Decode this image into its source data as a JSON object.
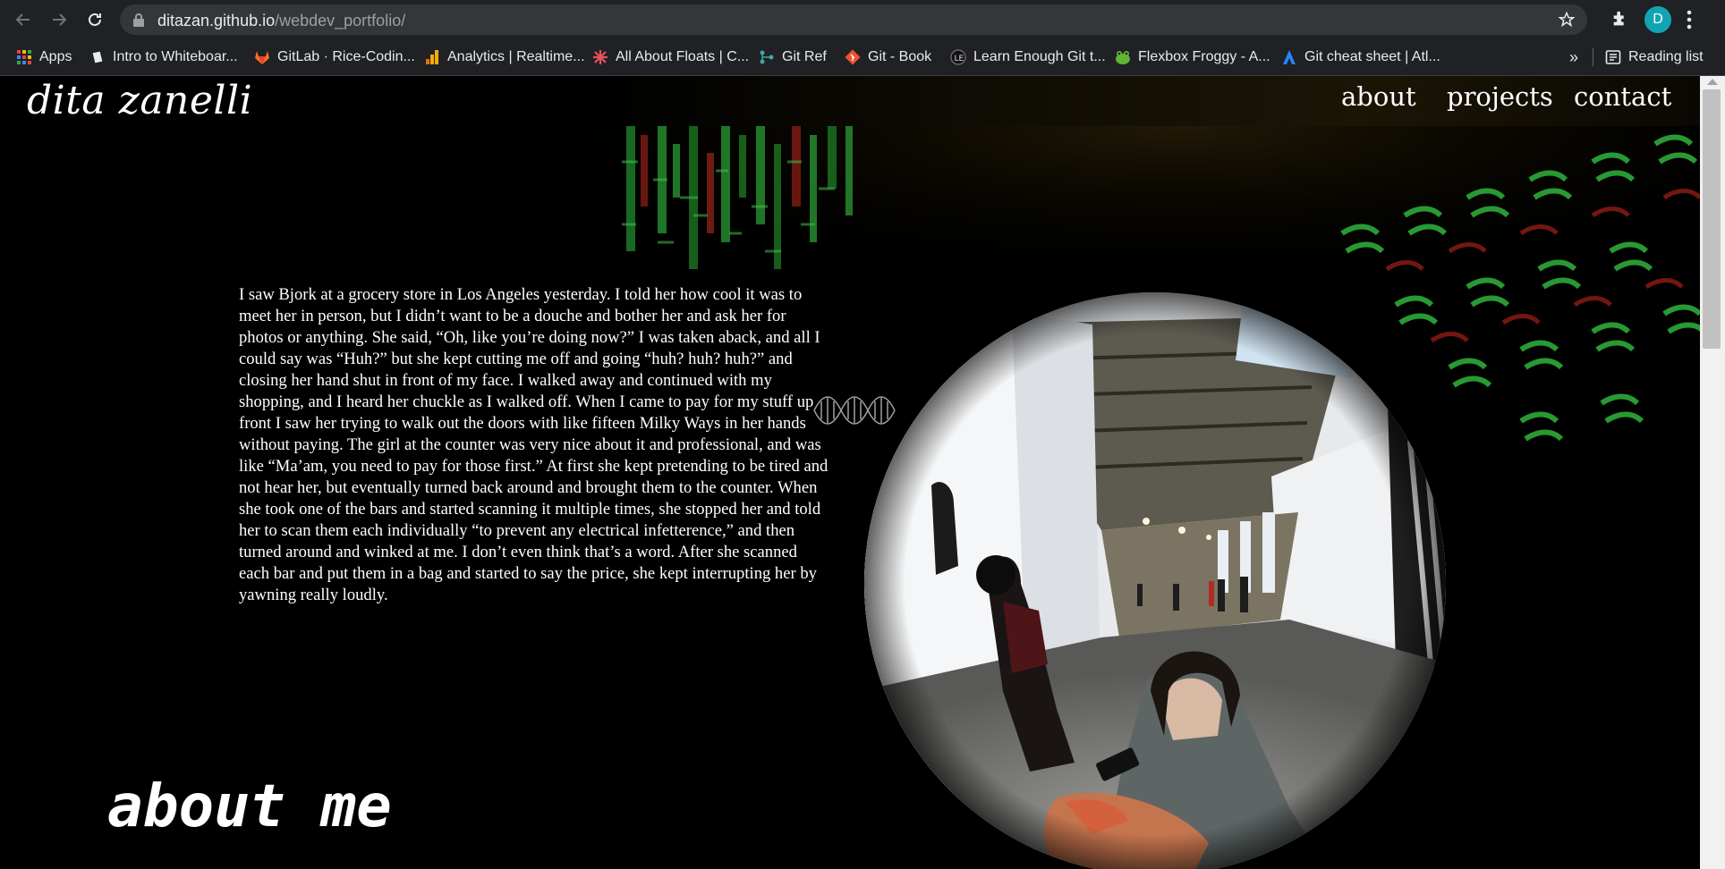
{
  "browser": {
    "url_host": "ditazan.github.io",
    "url_path": "/webdev_portfolio/",
    "profile_initial": "D",
    "bookmarks": [
      {
        "label": "Apps",
        "icon": "apps-grid-icon"
      },
      {
        "label": "Intro to Whiteboar...",
        "icon": "document-icon"
      },
      {
        "label": "GitLab · Rice-Codin...",
        "icon": "gitlab-icon"
      },
      {
        "label": "Analytics | Realtime...",
        "icon": "analytics-icon"
      },
      {
        "label": "All About Floats | C...",
        "icon": "css-tricks-icon"
      },
      {
        "label": "Git Ref",
        "icon": "git-ref-icon"
      },
      {
        "label": "Git - Book",
        "icon": "git-icon"
      },
      {
        "label": "Learn Enough Git t...",
        "icon": "learn-enough-icon"
      },
      {
        "label": "Flexbox Froggy - A...",
        "icon": "froggy-icon"
      },
      {
        "label": "Git cheat sheet | Atl...",
        "icon": "atlassian-icon"
      }
    ],
    "more_bookmarks": "»",
    "reading_list": "Reading list"
  },
  "site": {
    "brand": "dita zanelli",
    "nav": [
      "about",
      "projects",
      "contact"
    ],
    "story": "I saw Bjork at a grocery store in Los Angeles yesterday. I told her how cool it was to meet her in person, but I didn’t want to be a douche and bother her and ask her for photos or anything. She said, “Oh, like you’re doing now?” I was taken aback, and all I could say was “Huh?” but she kept cutting me off and going “huh? huh? huh?” and closing her hand shut in front of my face. I walked away and continued with my shopping, and I heard her chuckle as I walked off. When I came to pay for my stuff up front I saw her trying to walk out the doors with like fifteen Milky Ways in her hands without paying. The girl at the counter was very nice about it and professional, and was like “Ma’am, you need to pay for those first.” At first she kept pretending to be tired and not hear her, but eventually turned back around and brought them to the counter. When she took one of the bars and started scanning it multiple times, she stopped her and told her to scan them each individually “to prevent any electrical infetterence,” and then turned around and winked at me. I don’t even think that’s a word. After she scanned each bar and put them in a bag and started to say the price, she kept interrupting her by yawning really loudly.",
    "about_heading": "about me"
  }
}
